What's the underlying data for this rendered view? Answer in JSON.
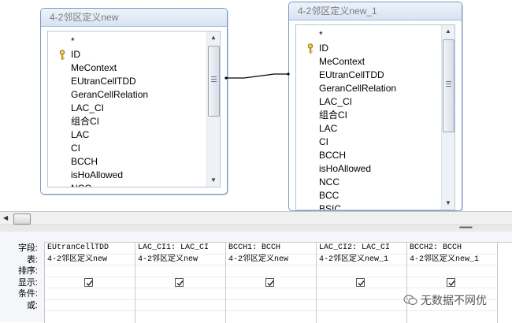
{
  "tables": [
    {
      "title": "4-2邻区定义new",
      "fields": [
        {
          "name": "*",
          "key": false
        },
        {
          "name": "ID",
          "key": true
        },
        {
          "name": "MeContext",
          "key": false
        },
        {
          "name": "EUtranCellTDD",
          "key": false
        },
        {
          "name": "GeranCellRelation",
          "key": false
        },
        {
          "name": "LAC_CI",
          "key": false
        },
        {
          "name": "组合CI",
          "key": false
        },
        {
          "name": "LAC",
          "key": false
        },
        {
          "name": "CI",
          "key": false
        },
        {
          "name": "BCCH",
          "key": false
        },
        {
          "name": "isHoAllowed",
          "key": false
        },
        {
          "name": "NCC",
          "key": false
        }
      ]
    },
    {
      "title": "4-2邻区定义new_1",
      "fields": [
        {
          "name": "*",
          "key": false
        },
        {
          "name": "ID",
          "key": true
        },
        {
          "name": "MeContext",
          "key": false
        },
        {
          "name": "EUtranCellTDD",
          "key": false
        },
        {
          "name": "GeranCellRelation",
          "key": false
        },
        {
          "name": "LAC_CI",
          "key": false
        },
        {
          "name": "组合CI",
          "key": false
        },
        {
          "name": "LAC",
          "key": false
        },
        {
          "name": "CI",
          "key": false
        },
        {
          "name": "BCCH",
          "key": false
        },
        {
          "name": "isHoAllowed",
          "key": false
        },
        {
          "name": "NCC",
          "key": false
        },
        {
          "name": "BCC",
          "key": false
        },
        {
          "name": "BSIC",
          "key": false
        }
      ]
    }
  ],
  "grid": {
    "row_labels": [
      "字段:",
      "表:",
      "排序:",
      "显示:",
      "条件:",
      "或:"
    ],
    "columns": [
      {
        "field": "EUtranCellTDD",
        "table": "4-2邻区定义new",
        "sort": "",
        "show": true
      },
      {
        "field": "LAC_CI1: LAC_CI",
        "table": "4-2邻区定义new",
        "sort": "",
        "show": true
      },
      {
        "field": "BCCH1: BCCH",
        "table": "4-2邻区定义new",
        "sort": "",
        "show": true
      },
      {
        "field": "LAC_CI2: LAC_CI",
        "table": "4-2邻区定义new_1",
        "sort": "",
        "show": true
      },
      {
        "field": "BCCH2: BCCH",
        "table": "4-2邻区定义new_1",
        "sort": "",
        "show": true
      }
    ]
  },
  "watermark": {
    "text": "无数据不网优",
    "icon": "wechat-icon"
  },
  "colors": {
    "table_border": "#7a98c2",
    "title_bar": "#d7e3f2",
    "grid_background": "#f4f6fa"
  }
}
